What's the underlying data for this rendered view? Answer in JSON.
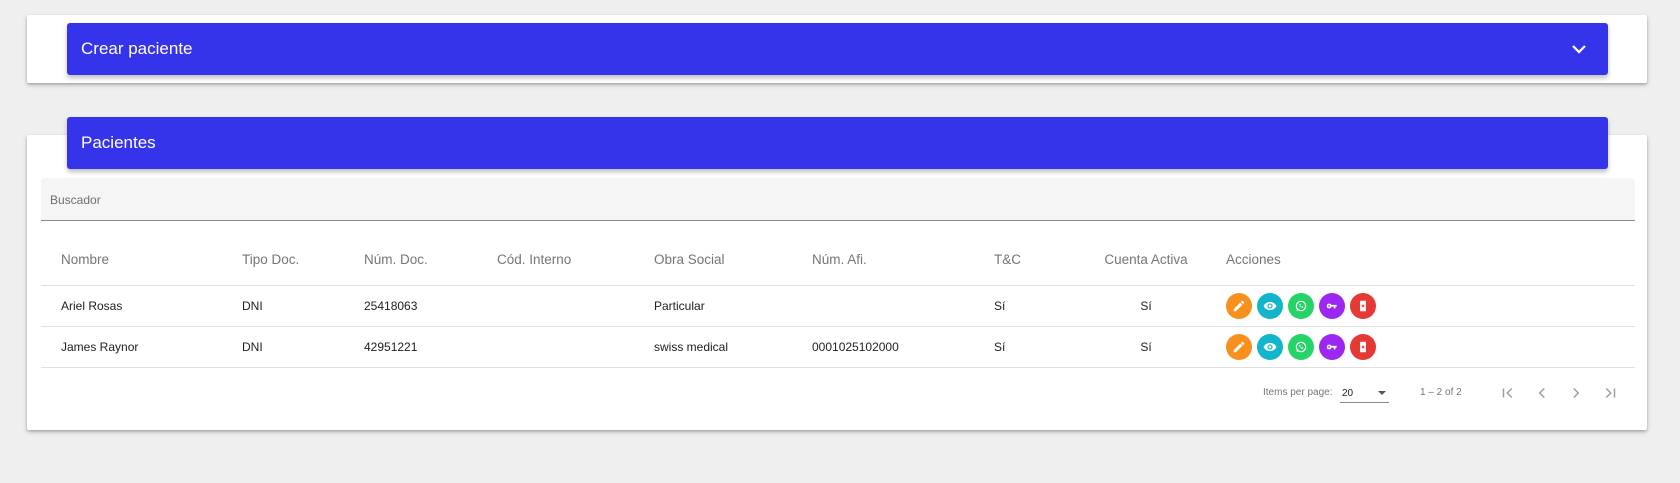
{
  "create_panel": {
    "title": "Crear paciente"
  },
  "patients_panel": {
    "title": "Pacientes",
    "search": {
      "placeholder": "Buscador",
      "value": ""
    },
    "columns": [
      "Nombre",
      "Tipo Doc.",
      "Núm. Doc.",
      "Cód. Interno",
      "Obra Social",
      "Núm. Afi.",
      "T&C",
      "Cuenta Activa",
      "Acciones"
    ],
    "rows": [
      {
        "nombre": "Ariel Rosas",
        "tipo_doc": "DNI",
        "num_doc": "25418063",
        "cod_interno": "",
        "obra_social": "Particular",
        "num_afi": "",
        "tyc": "Sí",
        "cuenta_activa": "Sí"
      },
      {
        "nombre": "James Raynor",
        "tipo_doc": "DNI",
        "num_doc": "42951221",
        "cod_interno": "",
        "obra_social": "swiss medical",
        "num_afi": "0001025102000",
        "tyc": "Sí",
        "cuenta_activa": "Sí"
      }
    ],
    "actions": [
      {
        "icon": "pencil-icon",
        "color": "#f7901e"
      },
      {
        "icon": "eye-icon",
        "color": "#12b5cb"
      },
      {
        "icon": "whatsapp-icon",
        "color": "#25d366"
      },
      {
        "icon": "key-icon",
        "color": "#9c27f0"
      },
      {
        "icon": "delete-icon",
        "color": "#e53935"
      }
    ]
  },
  "paginator": {
    "items_per_page_label": "Items per page:",
    "items_per_page_value": "20",
    "range_label": "1 – 2 of 2"
  },
  "colors": {
    "header_bar": "#3634ea",
    "background": "#efefef"
  }
}
